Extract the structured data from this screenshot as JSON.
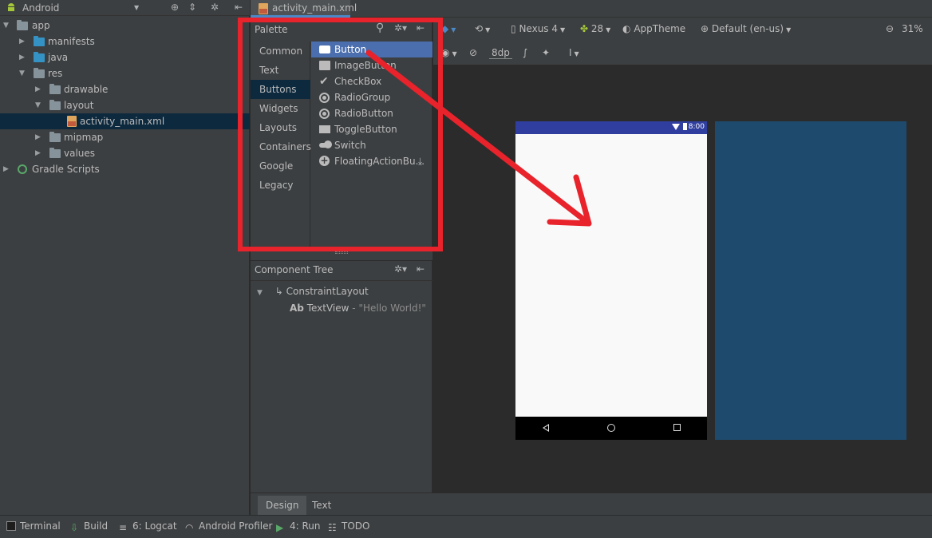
{
  "project_panel": {
    "view_title": "Android",
    "tree": [
      {
        "label": "app",
        "icon": "app-module-icon"
      },
      {
        "label": "manifests",
        "icon": "folder-icon"
      },
      {
        "label": "java",
        "icon": "folder-icon"
      },
      {
        "label": "res",
        "icon": "folder-icon"
      },
      {
        "label": "drawable",
        "icon": "folder-icon"
      },
      {
        "label": "layout",
        "icon": "folder-icon"
      },
      {
        "label": "activity_main.xml",
        "icon": "xml-file-icon",
        "selected": true
      },
      {
        "label": "mipmap",
        "icon": "folder-icon"
      },
      {
        "label": "values",
        "icon": "folder-icon"
      },
      {
        "label": "Gradle Scripts",
        "icon": "gradle-icon"
      }
    ]
  },
  "editor_tab": {
    "label": "activity_main.xml"
  },
  "palette": {
    "title": "Palette",
    "categories": [
      "Common",
      "Text",
      "Buttons",
      "Widgets",
      "Layouts",
      "Containers",
      "Google",
      "Legacy"
    ],
    "selected_category": "Buttons",
    "items": [
      "Button",
      "ImageButton",
      "CheckBox",
      "RadioGroup",
      "RadioButton",
      "ToggleButton",
      "Switch",
      "FloatingActionBu..."
    ],
    "selected_item": "Button"
  },
  "component_tree": {
    "title": "Component Tree",
    "root": "ConstraintLayout",
    "child_badge": "Ab",
    "child": "TextView",
    "child_hint": "- \"Hello World!\""
  },
  "toolbar": {
    "device": "Nexus 4",
    "api": "28",
    "theme": "AppTheme",
    "locale": "Default (en-us)",
    "zoom": "31%",
    "margin": "8dp"
  },
  "phone": {
    "time": "8:00",
    "status_color": "#303f9f"
  },
  "design_tabs": [
    "Design",
    "Text"
  ],
  "status_bar": [
    {
      "label": "Terminal",
      "icon": "terminal-icon"
    },
    {
      "label": "Build",
      "icon": "build-icon"
    },
    {
      "label": "6: Logcat",
      "icon": "logcat-icon"
    },
    {
      "label": "Android Profiler",
      "icon": "profiler-icon"
    },
    {
      "label": "4: Run",
      "icon": "run-icon"
    },
    {
      "label": "TODO",
      "icon": "todo-icon"
    }
  ],
  "colors": {
    "annotation_red": "#e8232b",
    "selection_blue": "#4b6eaf",
    "blueprint": "#1e4a6e"
  }
}
